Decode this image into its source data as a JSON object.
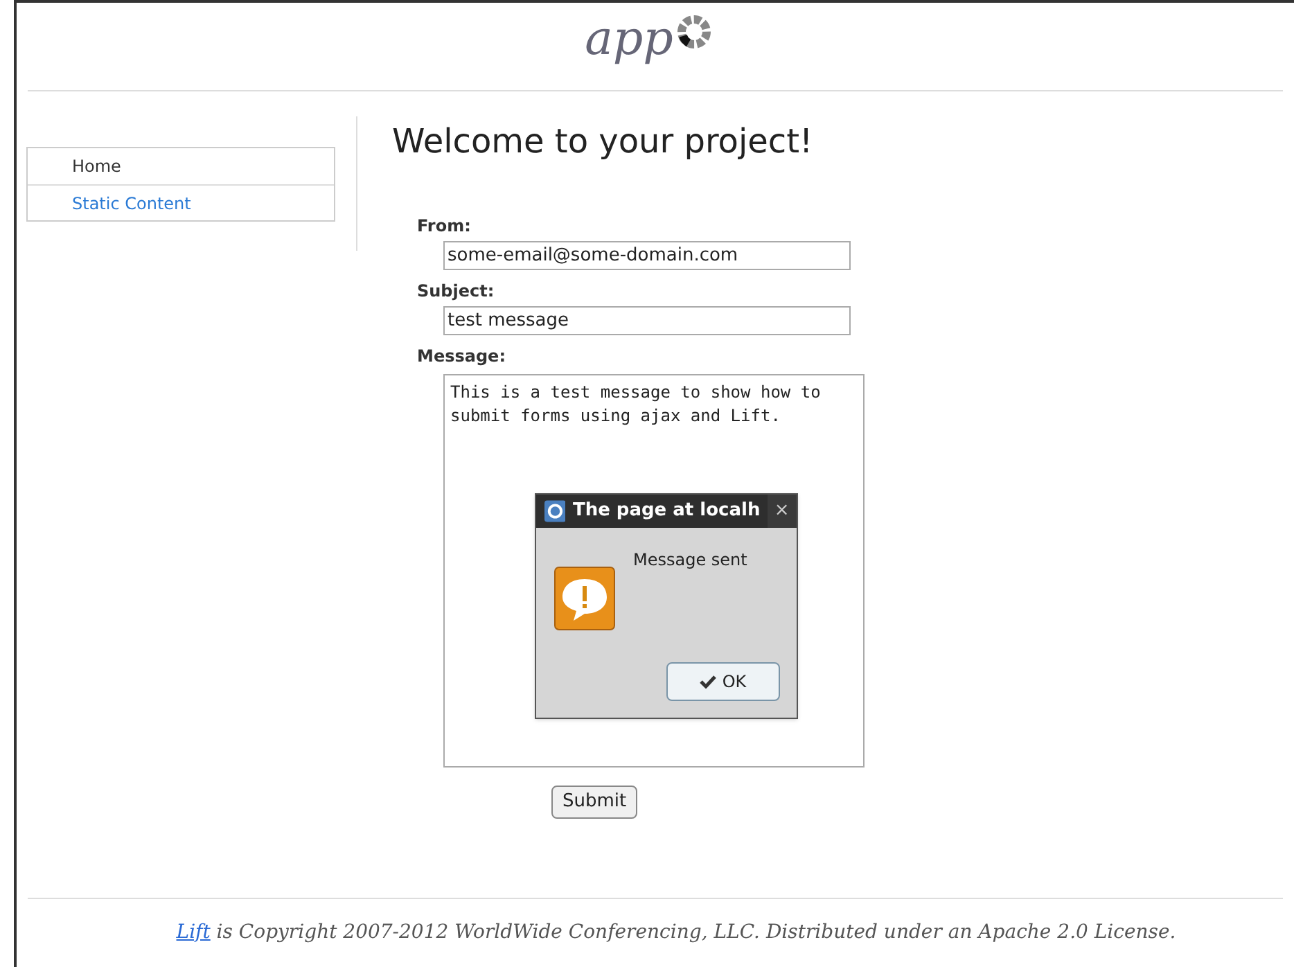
{
  "logo": {
    "text": "app"
  },
  "nav": [
    {
      "label": "Home",
      "selected": true
    },
    {
      "label": "Static Content",
      "selected": false
    }
  ],
  "heading": "Welcome to your project!",
  "form": {
    "fields": [
      {
        "kind": "input",
        "label": "From:",
        "value": "some-email@some-domain.com"
      },
      {
        "kind": "input",
        "label": "Subject:",
        "value": "test message"
      },
      {
        "kind": "textarea",
        "label": "Message:",
        "value": "This is a test message to show how to submit forms using ajax and Lift."
      }
    ],
    "submit": "Submit"
  },
  "dialog": {
    "title": "The page at localh",
    "close": "×",
    "message": "Message sent",
    "button": "OK"
  },
  "footer": {
    "link": "Lift",
    "text": " is Copyright 2007-2012 WorldWide Conferencing, LLC. Distributed under an Apache 2.0 License."
  }
}
